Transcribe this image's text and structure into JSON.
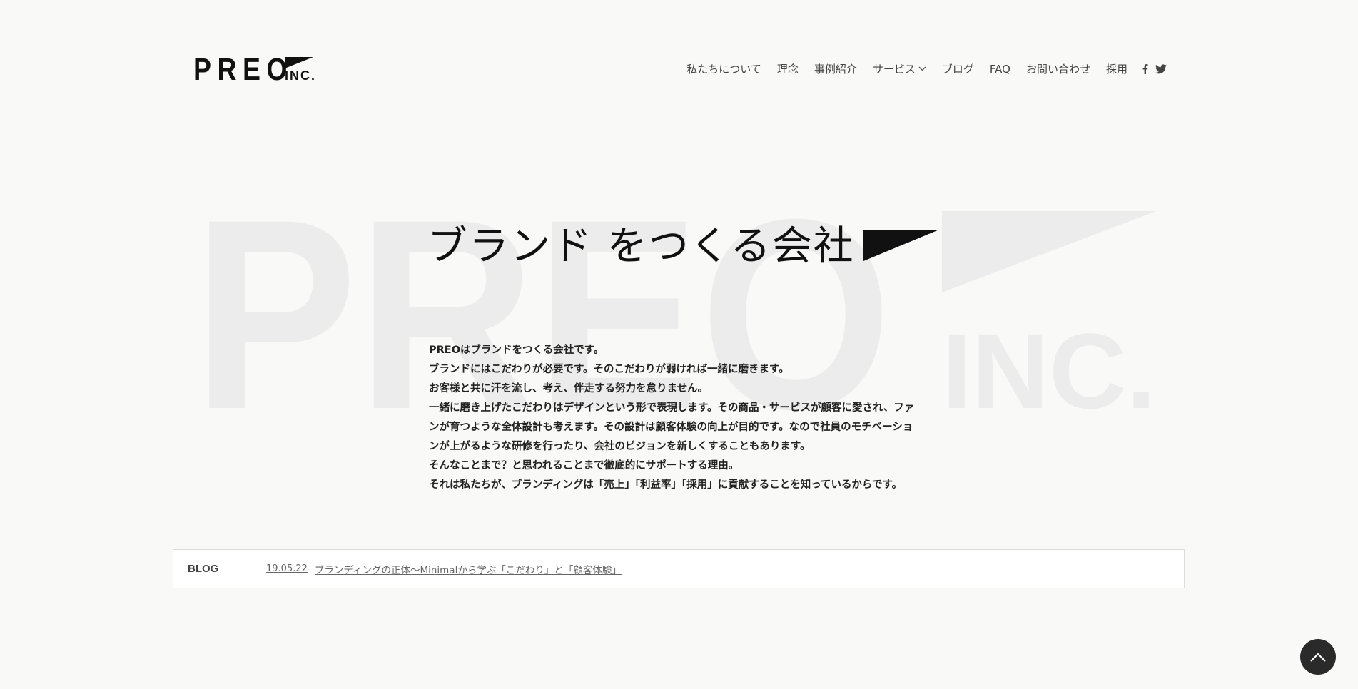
{
  "header": {
    "logo_text": "PREO",
    "logo_suffix": "INC.",
    "nav": [
      {
        "label": "私たちについて"
      },
      {
        "label": "理念"
      },
      {
        "label": "事例紹介"
      },
      {
        "label": "サービス"
      },
      {
        "label": "ブログ"
      },
      {
        "label": "FAQ"
      },
      {
        "label": "お問い合わせ"
      },
      {
        "label": "採用"
      }
    ],
    "social": [
      "facebook-icon",
      "twitter-icon"
    ]
  },
  "hero": {
    "title": "ブランド をつくる会社",
    "background_mark_text": "PREO INC.",
    "intro_lines": [
      "PREOはブランドをつくる会社です。",
      "ブランドにはこだわりが必要です。そのこだわりが弱ければ一緒に磨きます。",
      "お客様と共に汗を流し、考え、伴走する努力を怠りません。",
      "一緒に磨き上げたこだわりはデザインという形で表現します。その商品・サービスが顧客に愛され、ファ",
      "ンが育つような全体設計も考えます。その設計は顧客体験の向上が目的です。なので社員のモチベーショ",
      "ンが上がるような研修を行ったり、会社のビジョンを新しくすることもあります。",
      "そんなことまで？と思われることまで徹底的にサポートする理由。",
      "それは私たちが、ブランディングは「売上」「利益率」「採用」に貢献することを知っているからです。"
    ]
  },
  "blog": {
    "label": "BLOG",
    "date": "19.05.22",
    "post_title": "ブランディングの正体〜Minimalから学ぶ「こだわり」と「顧客体験」"
  },
  "colors": {
    "background": "#f9f9f7",
    "text": "#111111",
    "watermark": "#ececec",
    "to_top_button": "#2a2a2a"
  }
}
